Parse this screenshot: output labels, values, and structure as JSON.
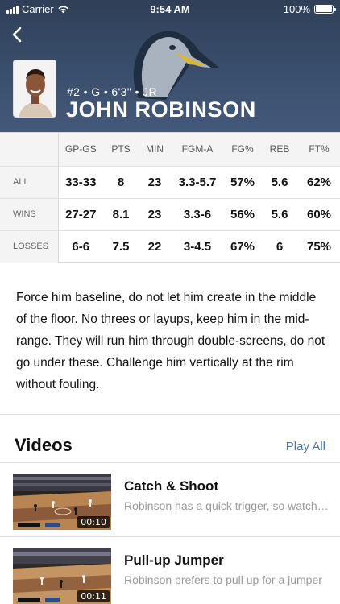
{
  "status_bar": {
    "carrier": "Carrier",
    "time": "9:54 AM",
    "battery": "100%"
  },
  "header": {
    "back_icon": "chevron-left-icon",
    "logo_icon": "bird-mascot-logo-icon",
    "player_meta": "#2 • G • 6'3\" • JR",
    "player_name": "JOHN ROBINSON"
  },
  "stats": {
    "columns": [
      "GP-GS",
      "PTS",
      "MIN",
      "FGM-A",
      "FG%",
      "REB",
      "FT%"
    ],
    "rows": [
      {
        "label": "ALL",
        "values": [
          "33-33",
          "8",
          "23",
          "3.3-5.7",
          "57%",
          "5.6",
          "62%"
        ]
      },
      {
        "label": "WINS",
        "values": [
          "27-27",
          "8.1",
          "23",
          "3.3-6",
          "56%",
          "5.6",
          "60%"
        ]
      },
      {
        "label": "LOSSES",
        "values": [
          "6-6",
          "7.5",
          "22",
          "3-4.5",
          "67%",
          "6",
          "75%"
        ]
      }
    ]
  },
  "scouting_note": "Force him baseline, do not let him create in the middle of the floor. No threes or layups, keep him in the mid-range. They will run him through double-screens, do not go under these. Challenge him vertically at the rim without fouling.",
  "videos": {
    "title": "Videos",
    "play_all": "Play All",
    "items": [
      {
        "title": "Catch & Shoot",
        "description": "Robinson has a quick trigger, so watch him closely",
        "duration": "00:10"
      },
      {
        "title": "Pull-up Jumper",
        "description": "Robinson prefers to pull up for a jumper",
        "duration": "00:11"
      }
    ]
  },
  "colors": {
    "header_bg": "#3a4f6d",
    "accent": "#4a78a6",
    "secondary_text": "#9a9a9a"
  }
}
